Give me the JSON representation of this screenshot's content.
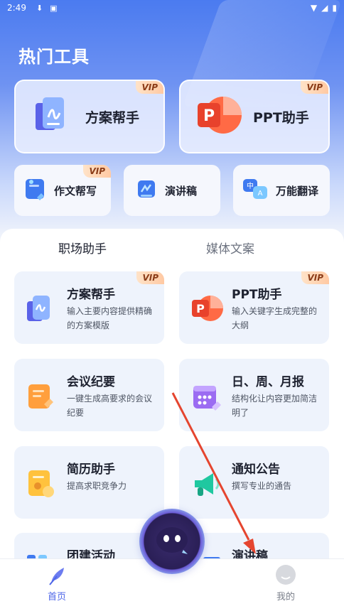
{
  "status_bar": {
    "time": "2:49"
  },
  "page_title": "热门工具",
  "vip_label": "VIP",
  "featured": [
    {
      "label": "方案帮手",
      "vip": true
    },
    {
      "label": "PPT助手",
      "vip": true
    }
  ],
  "quick_tools": [
    {
      "label": "作文帮写",
      "vip": true
    },
    {
      "label": "演讲稿",
      "vip": false
    },
    {
      "label": "万能翻译",
      "vip": false
    }
  ],
  "tabs": [
    {
      "label": "职场助手",
      "active": true
    },
    {
      "label": "媒体文案",
      "active": false
    }
  ],
  "tools": [
    {
      "title": "方案帮手",
      "desc": "输入主要内容提供精确的方案模版",
      "vip": true
    },
    {
      "title": "PPT助手",
      "desc": "输入关键字生成完整的大纲",
      "vip": true
    },
    {
      "title": "会议纪要",
      "desc": "一键生成高要求的会议纪要",
      "vip": false
    },
    {
      "title": "日、周、月报",
      "desc": "结构化让内容更加简洁明了",
      "vip": false
    },
    {
      "title": "简历助手",
      "desc": "提高求职竞争力",
      "vip": false
    },
    {
      "title": "通知公告",
      "desc": "撰写专业的通告",
      "vip": false
    },
    {
      "title": "团建活动",
      "desc": "",
      "vip": false
    },
    {
      "title": "演讲稿",
      "desc": "",
      "vip": false
    }
  ],
  "bottom_nav": {
    "home": "首页",
    "mine": "我的"
  },
  "colors": {
    "accent": "#4e66e8",
    "vip_bg": "#ffc9a3",
    "annotation_arrow": "#e5452f"
  }
}
